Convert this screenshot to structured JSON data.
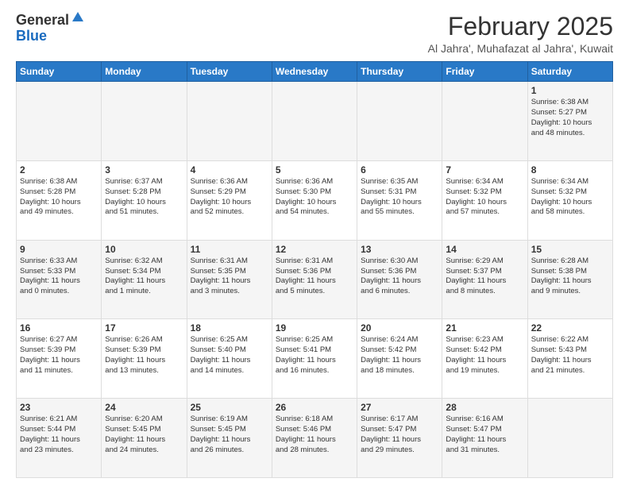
{
  "logo": {
    "line1": "General",
    "line2": "Blue"
  },
  "header": {
    "month_year": "February 2025",
    "location": "Al Jahra', Muhafazat al Jahra', Kuwait"
  },
  "weekdays": [
    "Sunday",
    "Monday",
    "Tuesday",
    "Wednesday",
    "Thursday",
    "Friday",
    "Saturday"
  ],
  "weeks": [
    [
      {
        "day": "",
        "info": ""
      },
      {
        "day": "",
        "info": ""
      },
      {
        "day": "",
        "info": ""
      },
      {
        "day": "",
        "info": ""
      },
      {
        "day": "",
        "info": ""
      },
      {
        "day": "",
        "info": ""
      },
      {
        "day": "1",
        "info": "Sunrise: 6:38 AM\nSunset: 5:27 PM\nDaylight: 10 hours\nand 48 minutes."
      }
    ],
    [
      {
        "day": "2",
        "info": "Sunrise: 6:38 AM\nSunset: 5:28 PM\nDaylight: 10 hours\nand 49 minutes."
      },
      {
        "day": "3",
        "info": "Sunrise: 6:37 AM\nSunset: 5:28 PM\nDaylight: 10 hours\nand 51 minutes."
      },
      {
        "day": "4",
        "info": "Sunrise: 6:36 AM\nSunset: 5:29 PM\nDaylight: 10 hours\nand 52 minutes."
      },
      {
        "day": "5",
        "info": "Sunrise: 6:36 AM\nSunset: 5:30 PM\nDaylight: 10 hours\nand 54 minutes."
      },
      {
        "day": "6",
        "info": "Sunrise: 6:35 AM\nSunset: 5:31 PM\nDaylight: 10 hours\nand 55 minutes."
      },
      {
        "day": "7",
        "info": "Sunrise: 6:34 AM\nSunset: 5:32 PM\nDaylight: 10 hours\nand 57 minutes."
      },
      {
        "day": "8",
        "info": "Sunrise: 6:34 AM\nSunset: 5:32 PM\nDaylight: 10 hours\nand 58 minutes."
      }
    ],
    [
      {
        "day": "9",
        "info": "Sunrise: 6:33 AM\nSunset: 5:33 PM\nDaylight: 11 hours\nand 0 minutes."
      },
      {
        "day": "10",
        "info": "Sunrise: 6:32 AM\nSunset: 5:34 PM\nDaylight: 11 hours\nand 1 minute."
      },
      {
        "day": "11",
        "info": "Sunrise: 6:31 AM\nSunset: 5:35 PM\nDaylight: 11 hours\nand 3 minutes."
      },
      {
        "day": "12",
        "info": "Sunrise: 6:31 AM\nSunset: 5:36 PM\nDaylight: 11 hours\nand 5 minutes."
      },
      {
        "day": "13",
        "info": "Sunrise: 6:30 AM\nSunset: 5:36 PM\nDaylight: 11 hours\nand 6 minutes."
      },
      {
        "day": "14",
        "info": "Sunrise: 6:29 AM\nSunset: 5:37 PM\nDaylight: 11 hours\nand 8 minutes."
      },
      {
        "day": "15",
        "info": "Sunrise: 6:28 AM\nSunset: 5:38 PM\nDaylight: 11 hours\nand 9 minutes."
      }
    ],
    [
      {
        "day": "16",
        "info": "Sunrise: 6:27 AM\nSunset: 5:39 PM\nDaylight: 11 hours\nand 11 minutes."
      },
      {
        "day": "17",
        "info": "Sunrise: 6:26 AM\nSunset: 5:39 PM\nDaylight: 11 hours\nand 13 minutes."
      },
      {
        "day": "18",
        "info": "Sunrise: 6:25 AM\nSunset: 5:40 PM\nDaylight: 11 hours\nand 14 minutes."
      },
      {
        "day": "19",
        "info": "Sunrise: 6:25 AM\nSunset: 5:41 PM\nDaylight: 11 hours\nand 16 minutes."
      },
      {
        "day": "20",
        "info": "Sunrise: 6:24 AM\nSunset: 5:42 PM\nDaylight: 11 hours\nand 18 minutes."
      },
      {
        "day": "21",
        "info": "Sunrise: 6:23 AM\nSunset: 5:42 PM\nDaylight: 11 hours\nand 19 minutes."
      },
      {
        "day": "22",
        "info": "Sunrise: 6:22 AM\nSunset: 5:43 PM\nDaylight: 11 hours\nand 21 minutes."
      }
    ],
    [
      {
        "day": "23",
        "info": "Sunrise: 6:21 AM\nSunset: 5:44 PM\nDaylight: 11 hours\nand 23 minutes."
      },
      {
        "day": "24",
        "info": "Sunrise: 6:20 AM\nSunset: 5:45 PM\nDaylight: 11 hours\nand 24 minutes."
      },
      {
        "day": "25",
        "info": "Sunrise: 6:19 AM\nSunset: 5:45 PM\nDaylight: 11 hours\nand 26 minutes."
      },
      {
        "day": "26",
        "info": "Sunrise: 6:18 AM\nSunset: 5:46 PM\nDaylight: 11 hours\nand 28 minutes."
      },
      {
        "day": "27",
        "info": "Sunrise: 6:17 AM\nSunset: 5:47 PM\nDaylight: 11 hours\nand 29 minutes."
      },
      {
        "day": "28",
        "info": "Sunrise: 6:16 AM\nSunset: 5:47 PM\nDaylight: 11 hours\nand 31 minutes."
      },
      {
        "day": "",
        "info": ""
      }
    ]
  ]
}
